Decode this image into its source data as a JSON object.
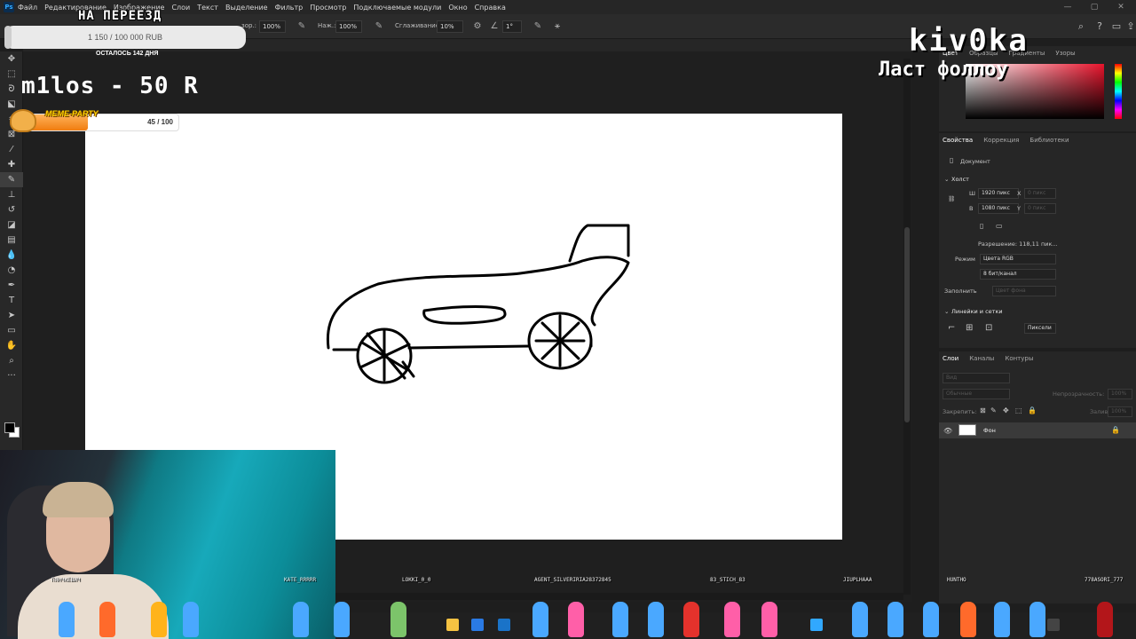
{
  "app": {
    "logo": "Ps",
    "menu": [
      "Файл",
      "Редактирование",
      "Изображение",
      "Слои",
      "Текст",
      "Выделение",
      "Фильтр",
      "Просмотр",
      "Подключаемые модули",
      "Окно",
      "Справка"
    ]
  },
  "options": {
    "opacity_label": "зор.:",
    "opacity_value": "100%",
    "pressure_label": "Наж.:",
    "pressure_value": "100%",
    "smoothing_label": "Сглаживание:",
    "smoothing_value": "10%",
    "angle_value": "1°"
  },
  "color_panel": {
    "tabs": [
      "Цвет",
      "Образцы",
      "Градиенты",
      "Узоры"
    ]
  },
  "properties": {
    "tabs": [
      "Свойства",
      "Коррекция",
      "Библиотеки"
    ],
    "doc_label": "Документ",
    "canvas_section": "Холст",
    "width_label": "Ш",
    "width_value": "1920 пикс",
    "height_label": "В",
    "height_value": "1080 пикс",
    "x_label": "X",
    "y_label": "Y",
    "coord_placeholder": "0 пикс",
    "resolution": "Разрешение: 118,11 пик...",
    "mode_label": "Режим",
    "mode_value": "Цвета RGB",
    "depth_value": "8 бит/канал",
    "fill_label": "Заполнить",
    "fill_value": "Цвет фона",
    "rulers_section": "Линейки и сетки",
    "units_value": "Пиксели"
  },
  "layers": {
    "tabs": [
      "Слои",
      "Каналы",
      "Контуры"
    ],
    "search_placeholder": "Вид",
    "blend_mode": "Обычные",
    "opacity_label": "Непрозрачность:",
    "opacity_value": "100%",
    "lock_label": "Закрепить:",
    "fill_label": "Заливка:",
    "fill_value": "100%",
    "layer_name": "Фон"
  },
  "overlay": {
    "goal_title": "НА ПЕРЕЕЗД",
    "goal_amount": "1 150 / 100 000 RUB",
    "goal_progress": 0.0115,
    "days_left": "ОСТАЛОСЬ 142 ДНЯ",
    "last_donation": "m1los - 50 R",
    "meme_label": "MEME-PARTY",
    "meme_count": "45 / 100",
    "meme_progress": 0.45,
    "channel_name": "kiv0ka",
    "last_follow": "Ласт фоллоу"
  },
  "chat_names": [
    "ПЯНЧКЕВИЧ",
    "KATE_RRRRR",
    "LOKKI_0_0",
    "AGENT_SILVERIRIA28372845",
    "83_STICH_83",
    "JIUPLHAAA",
    "HUNTHO",
    "778ASORI_777"
  ],
  "colors": {
    "accent": "#31a8ff",
    "canvas": "#ffffff",
    "workspace": "#1f1f1f",
    "panel": "#262626",
    "meme_bar": "#f07c10"
  }
}
